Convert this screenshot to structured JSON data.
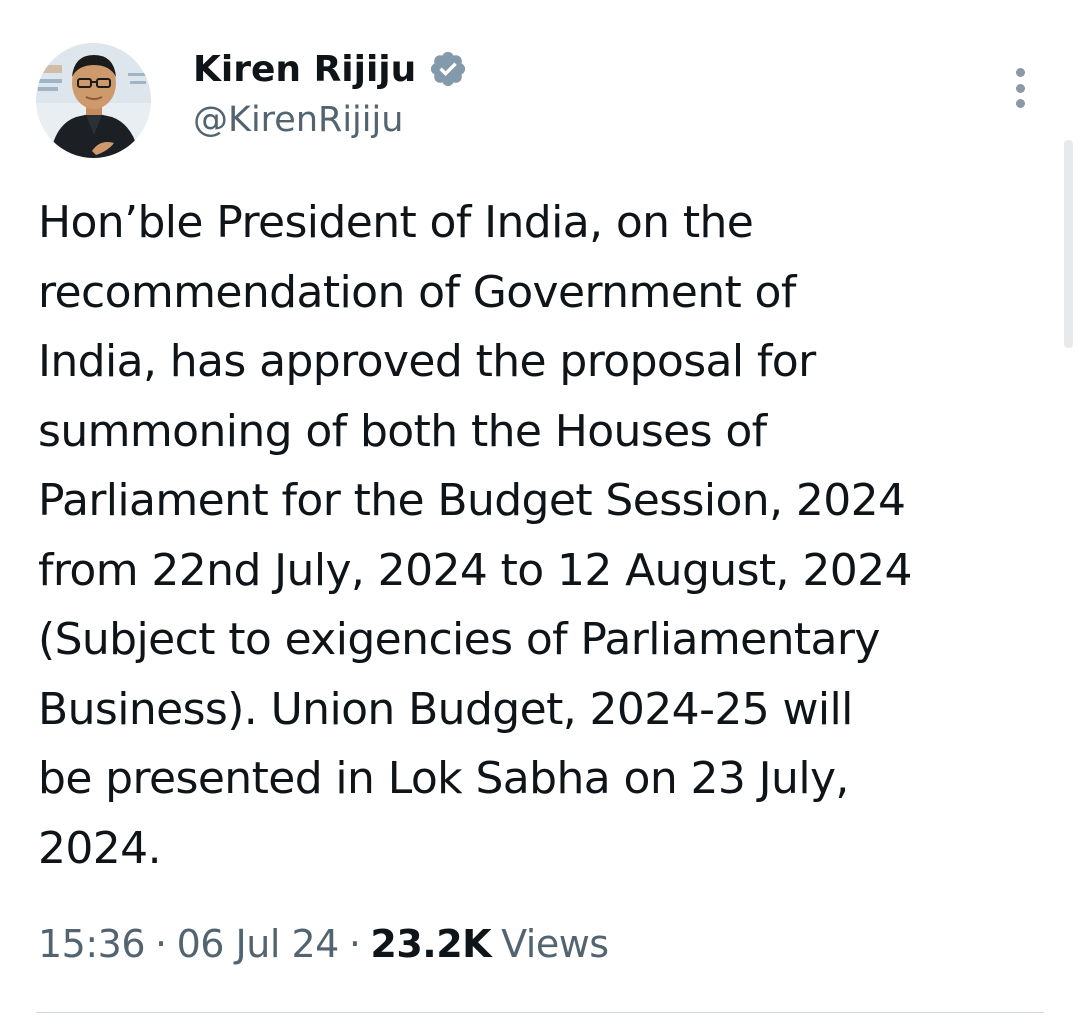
{
  "author": {
    "display_name": "Kiren Rijiju",
    "handle": "@KirenRijiju",
    "verified": true,
    "verified_icon": "verified-badge-icon",
    "verified_color": "#829aab"
  },
  "tweet": {
    "text": "Hon’ble President of India, on the\nrecommendation of Government of\nIndia, has approved the proposal for\nsummoning of both the Houses of\nParliament for the Budget Session, 2024\nfrom 22nd July, 2024 to 12 August, 2024\n(Subject to exigencies of Parliamentary\nBusiness). Union Budget, 2024-25 will\nbe presented in Lok Sabha on 23 July,\n2024."
  },
  "meta": {
    "time": "15:36",
    "separator": "·",
    "date": "06 Jul 24",
    "views_count": "23.2K",
    "views_label": "Views"
  },
  "icons": {
    "more": "more-options-icon"
  },
  "colors": {
    "text_primary": "#0f1419",
    "text_secondary": "#536471"
  }
}
